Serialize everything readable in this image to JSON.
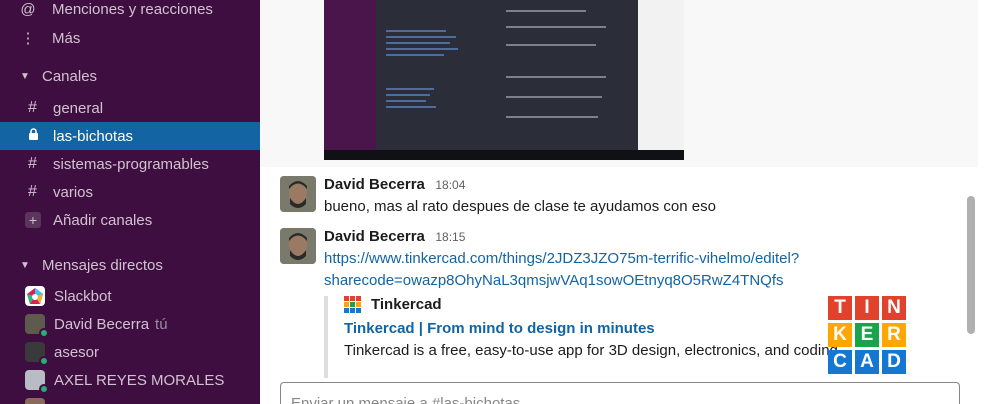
{
  "sidebar": {
    "mentions": {
      "icon": "at-icon",
      "label": "Menciones y reacciones"
    },
    "more": {
      "icon": "more-vertical-icon",
      "label": "Más"
    },
    "channels_header": "Canales",
    "channels": [
      {
        "name": "general",
        "active": false
      },
      {
        "name": "las-bichotas",
        "active": true
      },
      {
        "name": "sistemas-programables",
        "active": false
      },
      {
        "name": "varios",
        "active": false
      }
    ],
    "add_channels": "Añadir canales",
    "dm_header": "Mensajes directos",
    "dms": [
      {
        "name": "Slackbot",
        "suffix": ""
      },
      {
        "name": "David Becerra",
        "suffix": "tú"
      },
      {
        "name": "asesor",
        "suffix": ""
      },
      {
        "name": "AXEL REYES MORALES",
        "suffix": ""
      }
    ]
  },
  "messages": [
    {
      "author": "David Becerra",
      "time": "18:04",
      "text": "bueno, mas al rato despues de clase te ayudamos con eso"
    },
    {
      "author": "David Becerra",
      "time": "18:15",
      "link_line1": "https://www.tinkercad.com/things/2JDZ3JZO75m-terrific-vihelmo/editel?",
      "link_line2": "sharecode=owazp8OhyNaL3qmsjwVAq1sowOEtnyq8O5RwZ4TNQfs",
      "unfurl": {
        "site": "Tinkercad",
        "title": "Tinkercad | From mind to design in minutes",
        "description": "Tinkercad is a free, easy-to-use app for 3D design, electronics, and coding.",
        "logo_letters": [
          "T",
          "I",
          "N",
          "K",
          "E",
          "R",
          "C",
          "A",
          "D"
        ],
        "logo_colors": [
          "#e2412c",
          "#e2412c",
          "#e2412c",
          "#ffa600",
          "#19a44b",
          "#ffa600",
          "#1477d1",
          "#1477d1",
          "#1477d1"
        ]
      }
    }
  ],
  "composer": {
    "placeholder": "Enviar un mensaje a #las-bichotas"
  },
  "colors": {
    "sidebar_bg": "#3f0e40",
    "active_bg": "#1264a3",
    "link": "#1264a3",
    "presence": "#2bac76"
  }
}
